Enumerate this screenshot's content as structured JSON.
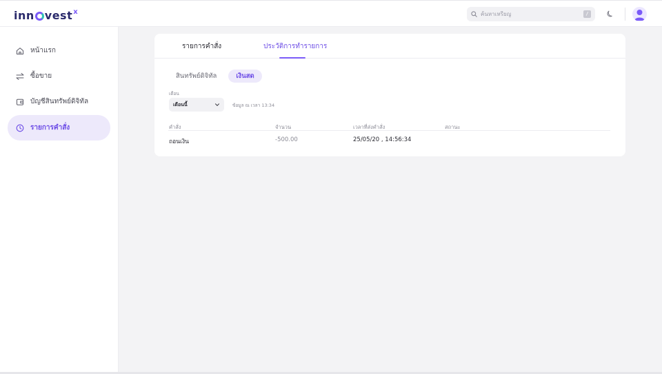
{
  "brand": {
    "logo_prefix": "inn",
    "logo_suffix": "vest",
    "logo_sup": "x"
  },
  "header": {
    "search_placeholder": "ค้นหาเหรียญ",
    "search_shortcut": "/",
    "theme_icon": "moon-icon",
    "avatar_icon": "user-icon"
  },
  "sidebar": {
    "items": [
      {
        "label": "หน้าแรก",
        "icon": "home-icon",
        "active": false
      },
      {
        "label": "ซื้อขาย",
        "icon": "swap-arrows-icon",
        "active": false
      },
      {
        "label": "บัญชีสินทรัพย์ดิจิทัล",
        "icon": "wallet-icon",
        "active": false
      },
      {
        "label": "รายการคำสั่ง",
        "icon": "clock-icon",
        "active": true
      }
    ]
  },
  "main": {
    "tabs": [
      {
        "label": "รายการคำสั่ง",
        "active": false
      },
      {
        "label": "ประวัติการทำรายการ",
        "active": true
      }
    ],
    "filters": [
      {
        "label": "สินทรัพย์ดิจิทัล",
        "active": false
      },
      {
        "label": "เงินสด",
        "active": true
      }
    ],
    "month_label": "เดือน",
    "month_select_value": "เดือนนี้",
    "updated_text": "ข้อมูล ณ เวลา 13:34",
    "table": {
      "headers": [
        "คำสั่ง",
        "จำนวน",
        "เวลาที่ส่งคำสั่ง",
        "สถานะ"
      ],
      "rows": [
        {
          "order": "ถอนเงิน",
          "amount": "-500.00",
          "time": "25/05/20 , 14:56:34",
          "status": ""
        }
      ]
    }
  },
  "colors": {
    "accent": "#7a5af8",
    "accent_text": "#6c4ce6",
    "active_bg": "#ede9fb",
    "page_bg": "#f3f3f5"
  }
}
